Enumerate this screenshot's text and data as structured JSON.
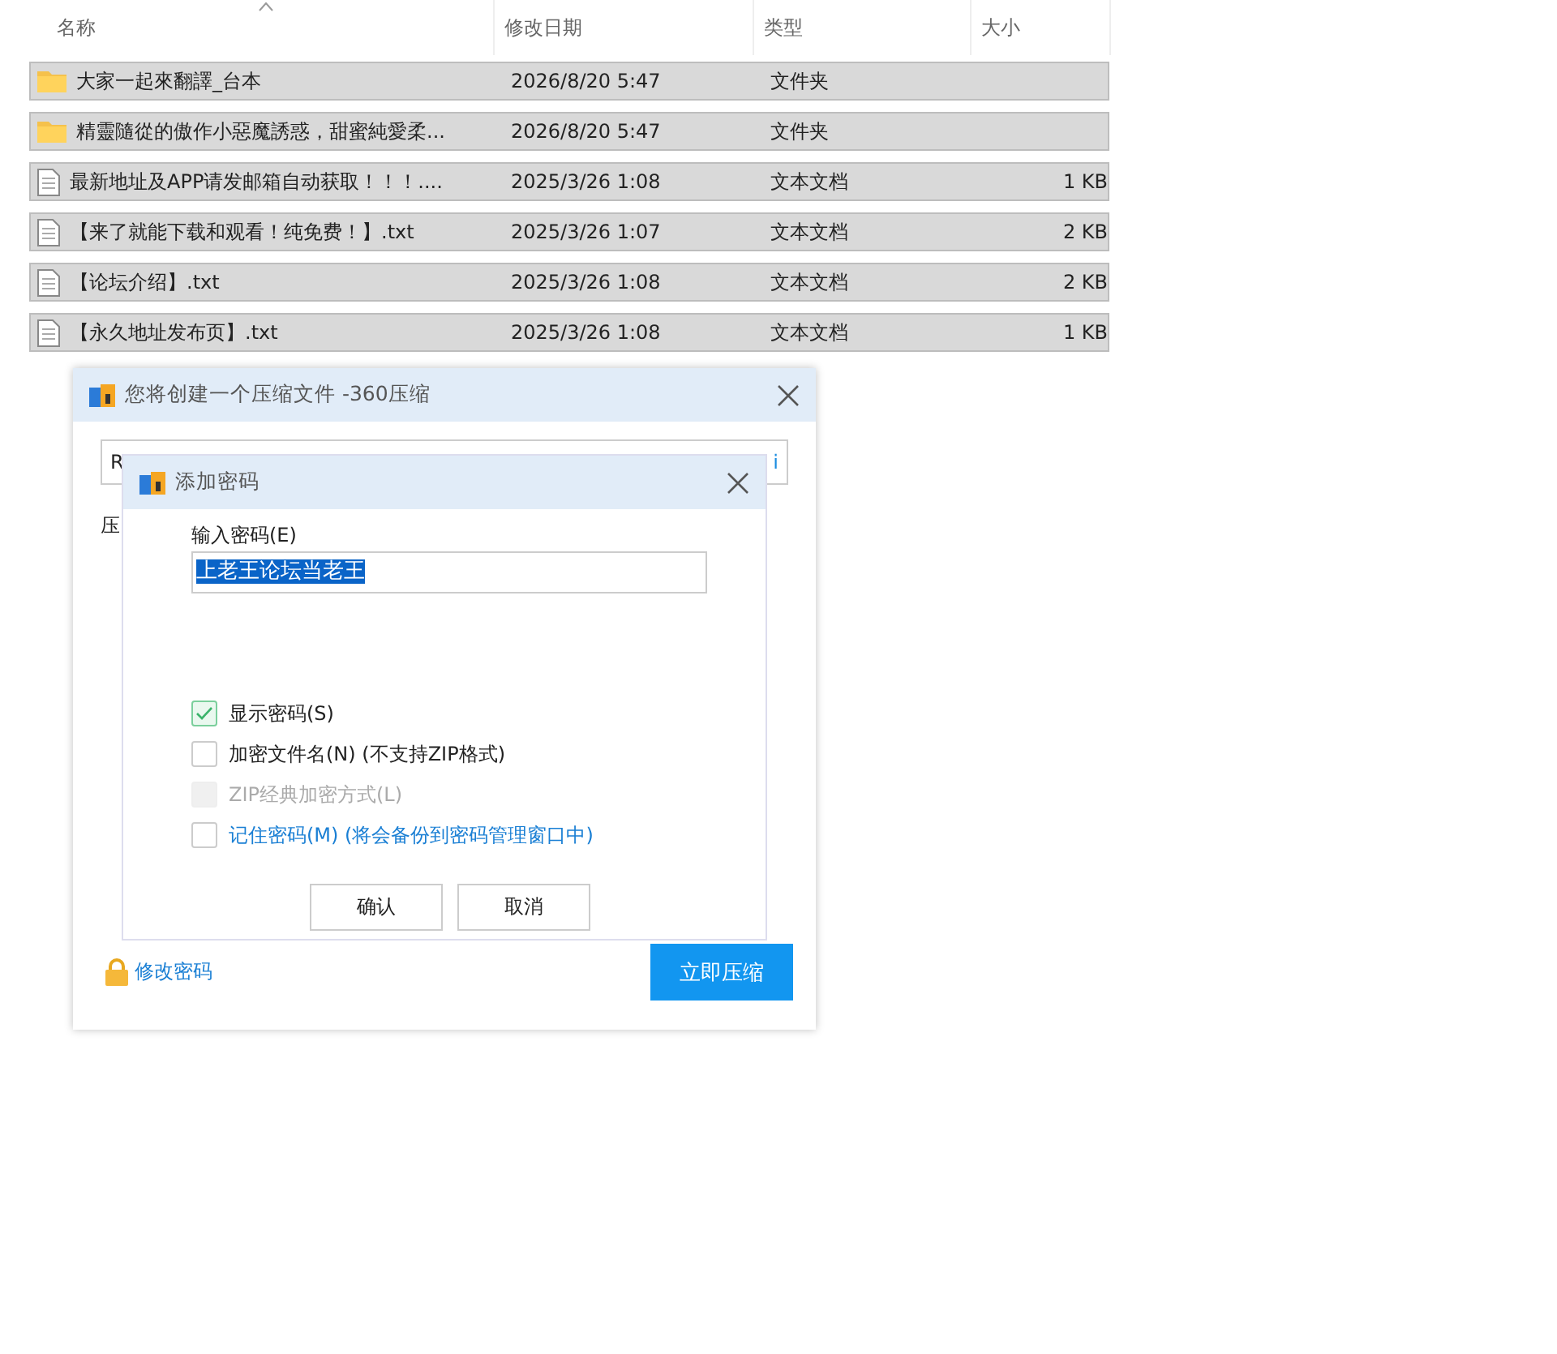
{
  "file_list": {
    "columns": [
      {
        "label": "名称",
        "sorted": true
      },
      {
        "label": "修改日期",
        "sorted": false
      },
      {
        "label": "类型",
        "sorted": false
      },
      {
        "label": "大小",
        "sorted": false
      }
    ],
    "rows": [
      {
        "kind": "folder",
        "name": "大家一起來翻譯_台本",
        "date": "2026/8/20 5:47",
        "type": "文件夹",
        "size": "",
        "selected": true
      },
      {
        "kind": "folder",
        "name": "精靈隨從的傲作小惡魔誘惑，甜蜜純愛柔...",
        "date": "2026/8/20 5:47",
        "type": "文件夹",
        "size": "",
        "selected": true
      },
      {
        "kind": "text",
        "name": "最新地址及APP请发邮箱自动获取！！！....",
        "date": "2025/3/26 1:08",
        "type": "文本文档",
        "size": "1 KB",
        "selected": true
      },
      {
        "kind": "text",
        "name": "【来了就能下载和观看！纯免费！】.txt",
        "date": "2025/3/26 1:07",
        "type": "文本文档",
        "size": "2 KB",
        "selected": true
      },
      {
        "kind": "text",
        "name": "【论坛介绍】.txt",
        "date": "2025/3/26 1:08",
        "type": "文本文档",
        "size": "2 KB",
        "selected": true
      },
      {
        "kind": "text",
        "name": "【永久地址发布页】.txt",
        "date": "2025/3/26 1:08",
        "type": "文本文档",
        "size": "1 KB",
        "selected": true
      }
    ]
  },
  "compress_dialog": {
    "title": "您将创建一个压缩文件 -360压缩",
    "path_field_start": "R",
    "path_field_end": "i",
    "label_start": "压",
    "change_password_link": "修改密码",
    "compress_button": "立即压缩"
  },
  "password_dialog": {
    "title": "添加密码",
    "password_label": "输入密码(E)",
    "password_value": "上老王论坛当老王",
    "options": [
      {
        "kind": "normal",
        "label": "显示密码(S)",
        "checked": true,
        "disabled": false
      },
      {
        "kind": "normal",
        "label": "加密文件名(N) (不支持ZIP格式)",
        "checked": false,
        "disabled": false
      },
      {
        "kind": "normal",
        "label": "ZIP经典加密方式(L)",
        "checked": false,
        "disabled": true
      },
      {
        "kind": "link",
        "label": "记住密码(M) (将会备份到密码管理窗口中)",
        "checked": false,
        "disabled": false
      }
    ],
    "buttons": [
      "确认",
      "取消"
    ]
  }
}
